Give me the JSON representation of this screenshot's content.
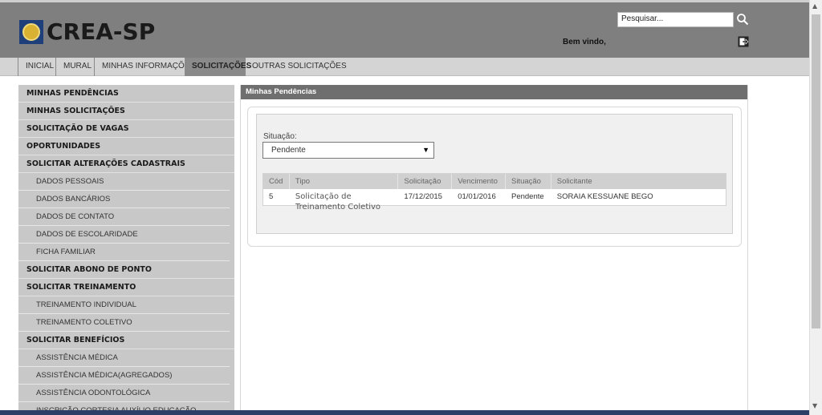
{
  "header": {
    "logo_text": "CREA-SP",
    "search_placeholder": "Pesquisar...",
    "welcome": "Bem vindo, f"
  },
  "nav": {
    "items": [
      {
        "label": "INICIAL"
      },
      {
        "label": "MURAL"
      },
      {
        "label": "MINHAS INFORMAÇÕES"
      },
      {
        "label": "SOLICITAÇÕES",
        "active": true
      },
      {
        "label": "OUTRAS SOLICITAÇÕES"
      }
    ]
  },
  "sidebar": {
    "items": [
      {
        "label": "MINHAS PENDÊNCIAS",
        "level": "top"
      },
      {
        "label": "MINHAS SOLICITAÇÕES",
        "level": "top"
      },
      {
        "label": "SOLICITAÇÃO DE VAGAS",
        "level": "top"
      },
      {
        "label": "OPORTUNIDADES",
        "level": "top"
      },
      {
        "label": "SOLICITAR ALTERAÇÕES CADASTRAIS",
        "level": "top"
      },
      {
        "label": "DADOS PESSOAIS",
        "level": "sub"
      },
      {
        "label": "DADOS BANCÁRIOS",
        "level": "sub"
      },
      {
        "label": "DADOS DE CONTATO",
        "level": "sub"
      },
      {
        "label": "DADOS DE ESCOLARIDADE",
        "level": "sub"
      },
      {
        "label": "FICHA FAMILIAR",
        "level": "sub"
      },
      {
        "label": "SOLICITAR ABONO DE PONTO",
        "level": "top"
      },
      {
        "label": "SOLICITAR TREINAMENTO",
        "level": "top"
      },
      {
        "label": "TREINAMENTO INDIVIDUAL",
        "level": "sub"
      },
      {
        "label": "TREINAMENTO COLETIVO",
        "level": "sub"
      },
      {
        "label": "SOLICITAR BENEFÍCIOS",
        "level": "top"
      },
      {
        "label": "ASSISTÊNCIA MÉDICA",
        "level": "sub"
      },
      {
        "label": "ASSISTÊNCIA MÉDICA(AGREGADOS)",
        "level": "sub"
      },
      {
        "label": "ASSISTÊNCIA ODONTOLÓGICA",
        "level": "sub"
      },
      {
        "label": "INSCRIÇÃO CORTESIA AUXÍLIO EDUCAÇÃO",
        "level": "sub"
      }
    ]
  },
  "main": {
    "panel_title": "Minhas Pendências",
    "situacao_label": "Situação:",
    "situacao_value": "Pendente",
    "table": {
      "headers": [
        "Cód",
        "Tipo",
        "Solicitação",
        "Vencimento",
        "Situação",
        "Solicitante"
      ],
      "rows": [
        [
          "5",
          "Solicitação de Treinamento Coletivo",
          "17/12/2015",
          "01/01/2016",
          "Pendente",
          "SORAIA KESSUANE BEGO"
        ]
      ]
    }
  },
  "colors": {
    "header_bg": "#7f7f7f",
    "nav_active_bg": "#8a8a8a",
    "sidebar_bg": "#c8c8c8",
    "panel_title_bg": "#6f6f6f"
  },
  "icons": [
    "search-icon",
    "logout-icon",
    "crea-seal-logo"
  ]
}
